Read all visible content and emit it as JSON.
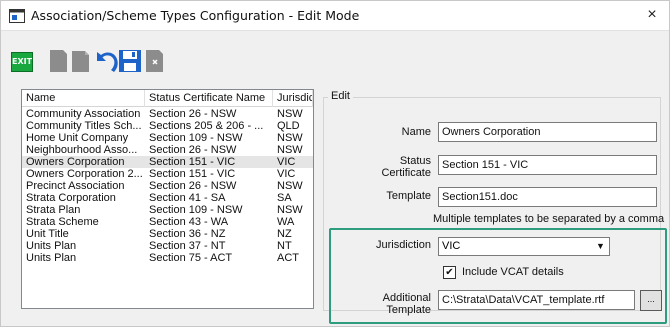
{
  "window": {
    "title": "Association/Scheme Types Configuration - Edit Mode",
    "close_glyph": "×"
  },
  "toolbar": {
    "exit_label": "EXIT",
    "buttons": [
      "exit-icon",
      "new-document-icon",
      "copy-document-icon",
      "undo-icon",
      "save-icon",
      "delete-document-icon"
    ]
  },
  "list": {
    "columns": [
      "Name",
      "Status Certificate Name",
      "Jurisdict..."
    ],
    "rows": [
      [
        "Community Association",
        "Section 26 - NSW",
        "NSW"
      ],
      [
        "Community Titles Sch...",
        "Sections 205 & 206 - ...",
        "QLD"
      ],
      [
        "Home Unit Company",
        "Section 109 - NSW",
        "NSW"
      ],
      [
        "Neighbourhood Asso...",
        "Section 26 - NSW",
        "NSW"
      ],
      [
        "Owners Corporation",
        "Section 151 - VIC",
        "VIC"
      ],
      [
        "Owners Corporation 2...",
        "Section 151 - VIC",
        "VIC"
      ],
      [
        "Precinct Association",
        "Section 26 - NSW",
        "NSW"
      ],
      [
        "Strata Corporation",
        "Section 41 - SA",
        "SA"
      ],
      [
        "Strata Plan",
        "Section 109 - NSW",
        "NSW"
      ],
      [
        "Strata Scheme",
        "Section 43 - WA",
        "WA"
      ],
      [
        "Unit Title",
        "Section 36 - NZ",
        "NZ"
      ],
      [
        "Units Plan",
        "Section 37 - NT",
        "NT"
      ],
      [
        "Units Plan",
        "Section 75 - ACT",
        "ACT"
      ]
    ],
    "selected_index": 4
  },
  "edit": {
    "group_label": "Edit",
    "name_label": "Name",
    "name_value": "Owners Corporation",
    "status_label_line1": "Status",
    "status_label_line2": "Certificate",
    "status_value": "Section 151 - VIC",
    "template_label": "Template",
    "template_value": "Section151.doc",
    "template_hint": "Multiple templates to be separated by a comma",
    "jurisdiction_label": "Jurisdiction",
    "jurisdiction_value": "VIC",
    "include_vcat_label": "Include VCAT details",
    "include_vcat_checked": true,
    "additional_label_line1": "Additional",
    "additional_label_line2": "Template",
    "additional_value": "C:\\Strata\\Data\\VCAT_template.rtf",
    "browse_label": "...",
    "dropdown_glyph": "▼",
    "check_glyph": "✔"
  },
  "colors": {
    "highlight": "#2e9c7f",
    "exit_green": "#19a83f",
    "accent_blue": "#1e63c8"
  }
}
